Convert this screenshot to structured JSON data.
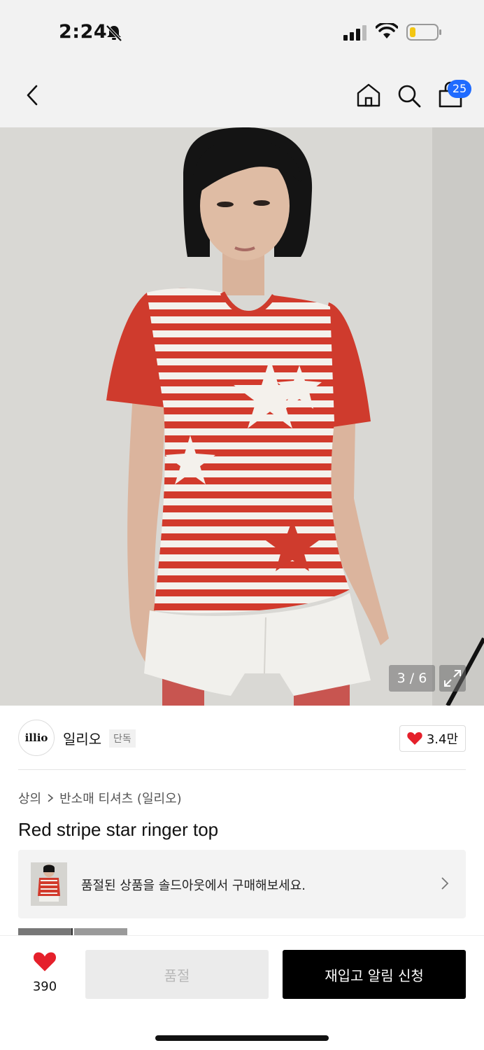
{
  "status_bar": {
    "time": "2:24",
    "icons": [
      "bell-slash-icon",
      "signal-icon",
      "wifi-icon",
      "battery-icon"
    ]
  },
  "nav": {
    "icons": [
      "back-icon",
      "home-icon",
      "search-icon",
      "cart-icon"
    ],
    "cart_count": "25"
  },
  "gallery": {
    "counter": "3 / 6",
    "expand_icon": "expand-icon"
  },
  "brand": {
    "logo_text": "illio",
    "name": "일리오",
    "badge": "단독",
    "likes": "3.4만"
  },
  "product": {
    "breadcrumb": [
      "상의",
      "반소매 티셔츠 (일리오)"
    ],
    "title": "Red stripe star ringer top"
  },
  "soldout_banner": {
    "text": "품절된 상품을 솔드아웃에서 구매해보세요."
  },
  "bottom": {
    "wish_count": "390",
    "soldout_label": "품절",
    "restock_label": "재입고 알림 신청"
  },
  "colors": {
    "accent": "#1f6bff",
    "heart": "#e5202b",
    "shirt_red": "#d23a2c"
  }
}
